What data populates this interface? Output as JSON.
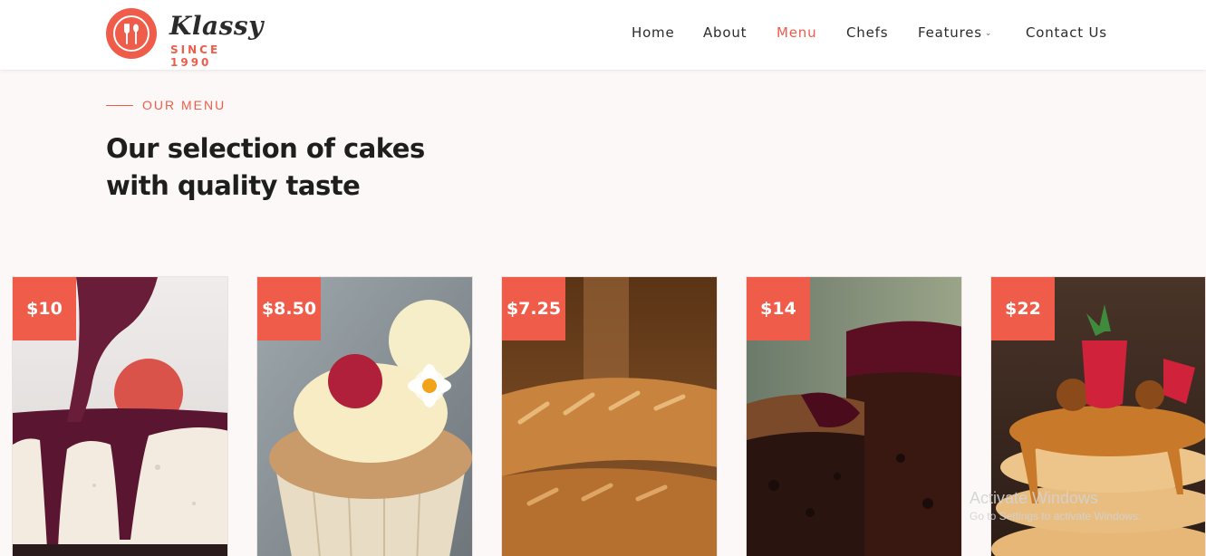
{
  "brand": {
    "name": "Klassy",
    "tagline": "SINCE 1990"
  },
  "nav": {
    "items": [
      {
        "label": "Home"
      },
      {
        "label": "About"
      },
      {
        "label": "Menu"
      },
      {
        "label": "Chefs"
      },
      {
        "label": "Features"
      },
      {
        "label": "Contact Us"
      }
    ],
    "active": "Menu",
    "features_has_dropdown": true
  },
  "section": {
    "eyebrow": "OUR MENU",
    "title_line1": "Our selection of cakes",
    "title_line2": "with quality taste"
  },
  "cards": [
    {
      "price": "$10",
      "image": "cheesecake-with-berry-sauce"
    },
    {
      "price": "$8.50",
      "image": "cupcake-with-raspberry-and-flower"
    },
    {
      "price": "$7.25",
      "image": "baguettes"
    },
    {
      "price": "$14",
      "image": "chocolate-cake-slice"
    },
    {
      "price": "$22",
      "image": "pancakes-with-strawberry"
    }
  ],
  "watermark": {
    "line1": "Activate Windows",
    "line2": "Go to Settings to activate Windows."
  },
  "colors": {
    "accent": "#f05c4a",
    "text_dark": "#1e1e1e",
    "background": "#fcf8f7",
    "header_bg": "#ffffff"
  }
}
